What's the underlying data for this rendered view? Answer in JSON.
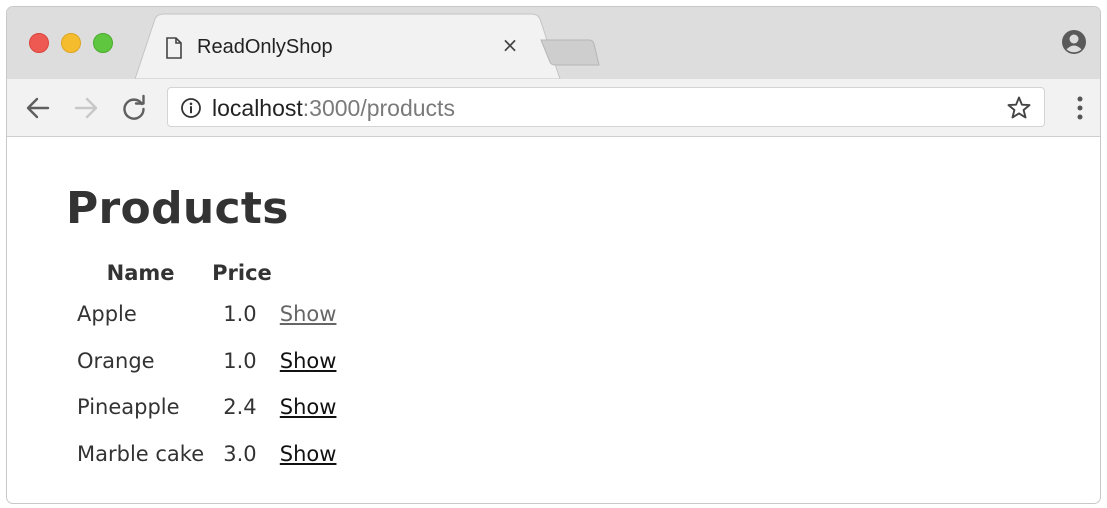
{
  "browser": {
    "tab_title": "ReadOnlyShop",
    "tab_close": "×",
    "url_host": "localhost",
    "url_rest": ":3000/products"
  },
  "icons": [
    "close-window-icon",
    "minimize-window-icon",
    "maximize-window-icon",
    "document-icon",
    "back-arrow-icon",
    "forward-arrow-icon",
    "reload-icon",
    "info-icon",
    "star-icon",
    "menu-icon",
    "profile-icon"
  ],
  "page": {
    "heading": "Products",
    "table": {
      "headers": [
        "Name",
        "Price",
        ""
      ],
      "rows": [
        {
          "name": "Apple",
          "price": "1.0",
          "action": "Show"
        },
        {
          "name": "Orange",
          "price": "1.0",
          "action": "Show"
        },
        {
          "name": "Pineapple",
          "price": "2.4",
          "action": "Show"
        },
        {
          "name": "Marble cake",
          "price": "3.0",
          "action": "Show"
        }
      ]
    }
  },
  "colors": {
    "close": "#ee5a52",
    "minimize": "#f5bd2d",
    "maximize": "#5fc63f",
    "heading": "#333333",
    "visited_link": "#666666"
  }
}
